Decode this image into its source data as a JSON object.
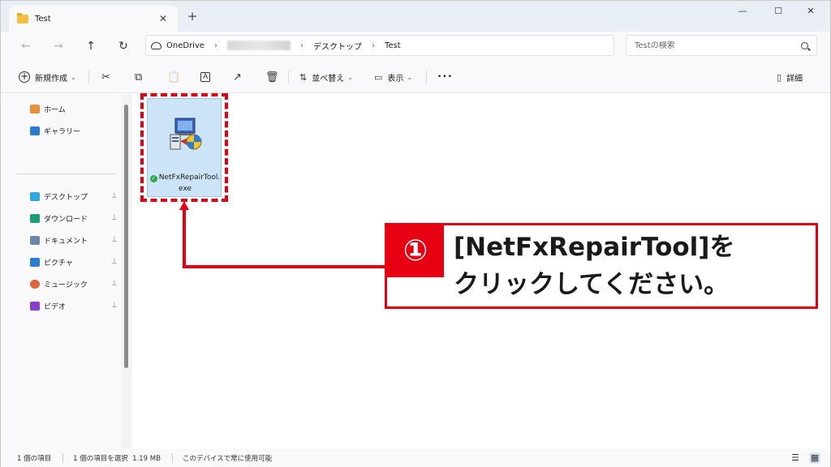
{
  "window": {
    "tab_title": "Test",
    "tab_close": "✕",
    "tab_add": "+",
    "minimize": "—",
    "maximize": "☐",
    "close": "✕"
  },
  "nav": {
    "back": "←",
    "forward": "→",
    "up": "↑",
    "refresh": "↻",
    "breadcrumb": [
      "OneDrive",
      "デスクトップ",
      "Test"
    ],
    "separator": "›",
    "search_placeholder": "Testの検索"
  },
  "toolbar": {
    "new_label": "新規作成",
    "sort_label": "並べ替え",
    "view_label": "表示",
    "more": "•••",
    "details_label": "詳細",
    "cut": "✂",
    "copy": "⧉",
    "paste": "📋",
    "rename": "A",
    "share": "↗",
    "delete": "🗑",
    "chevron": "⌄"
  },
  "sidebar": {
    "items": [
      {
        "label": "ホーム",
        "color": "#e8913a",
        "pinned": false
      },
      {
        "label": "ギャラリー",
        "color": "#2b7bd3",
        "pinned": false
      },
      {
        "label": "デスクトップ",
        "color": "#2ea8e0",
        "pinned": true
      },
      {
        "label": "ダウンロード",
        "color": "#1e9e6f",
        "pinned": true
      },
      {
        "label": "ドキュメント",
        "color": "#6e86a8",
        "pinned": true
      },
      {
        "label": "ピクチャ",
        "color": "#2b7bd3",
        "pinned": true
      },
      {
        "label": "ミュージック",
        "color": "#e0643a",
        "pinned": true
      },
      {
        "label": "ビデオ",
        "color": "#8a3fd1",
        "pinned": true
      }
    ],
    "pin_glyph": "📌"
  },
  "file": {
    "name_line1": "NetFxRepairTool.",
    "name_line2": "exe",
    "status_check": "✓"
  },
  "callout": {
    "number": "①",
    "line1": "[NetFxRepairTool]を",
    "line2": "クリックしてください。"
  },
  "status": {
    "count": "1 個の項目",
    "selected": "1 個の項目を選択  1.19 MB",
    "availability": "このデバイスで常に使用可能",
    "list_view": "☰",
    "grid_view": "▦"
  }
}
